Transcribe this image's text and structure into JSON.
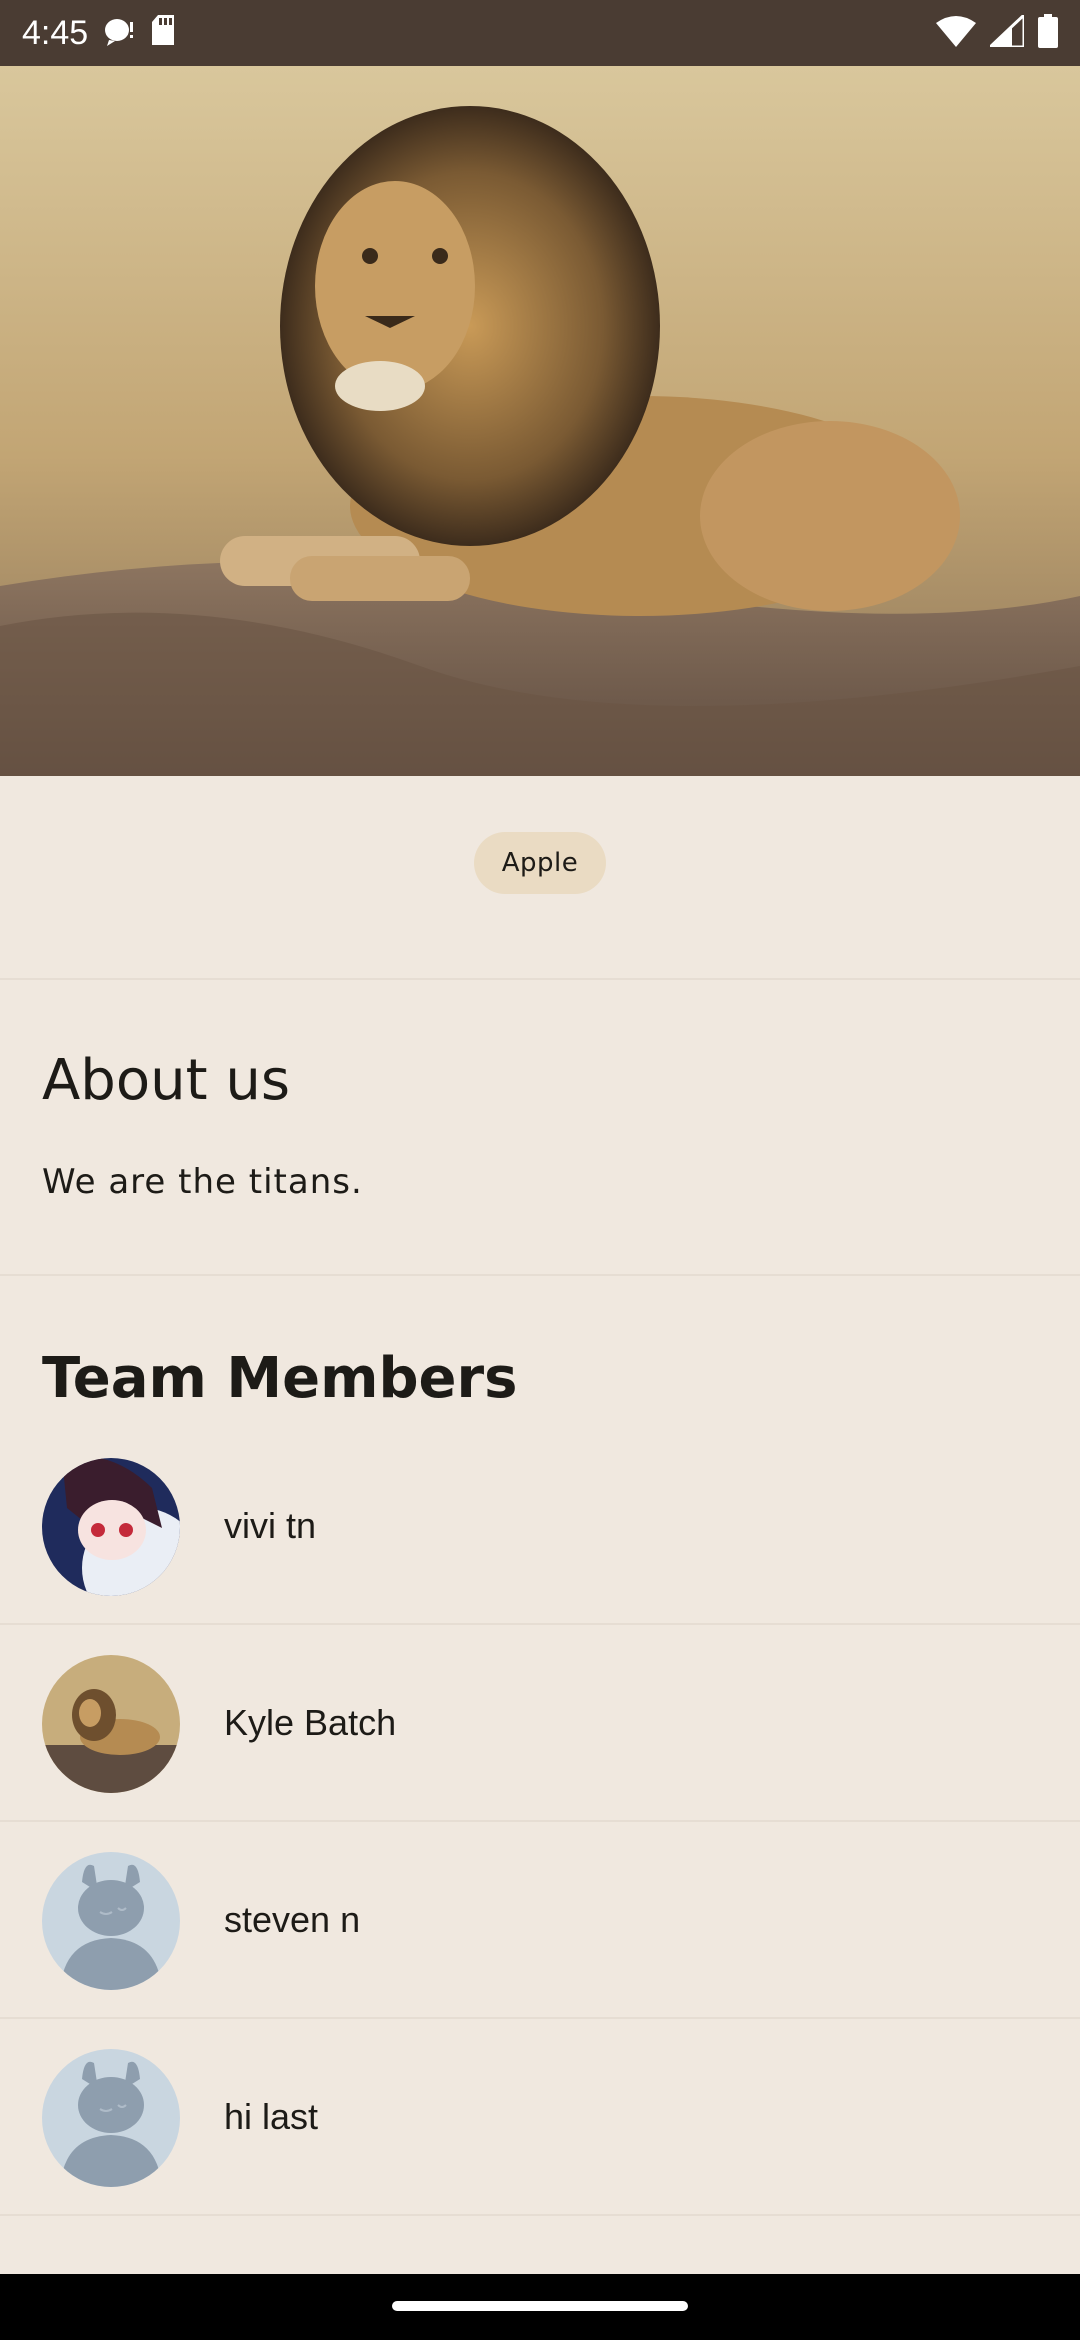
{
  "status_bar": {
    "time": "4:45",
    "icons_left": [
      "talkback-icon",
      "sd-card-icon"
    ],
    "icons_right": [
      "wifi-icon",
      "signal-icon",
      "battery-icon"
    ]
  },
  "hero": {
    "image": "lion-photo"
  },
  "chip": {
    "label": "Apple"
  },
  "about": {
    "title": "About us",
    "text": "We are the titans."
  },
  "team": {
    "title": "Team Members",
    "members": [
      {
        "name": "vivi tn",
        "avatar": "anime-avatar"
      },
      {
        "name": "Kyle Batch",
        "avatar": "lion-avatar"
      },
      {
        "name": "steven n",
        "avatar": "default-avatar"
      },
      {
        "name": "hi last",
        "avatar": "default-avatar"
      }
    ]
  },
  "colors": {
    "background": "#f0e8df",
    "status_bar": "#4a3c33",
    "chip": "#eadbc3",
    "divider": "#e6ddd3",
    "avatar_default_bg": "#c9d6e0",
    "avatar_default_fg": "#8e9eae"
  }
}
